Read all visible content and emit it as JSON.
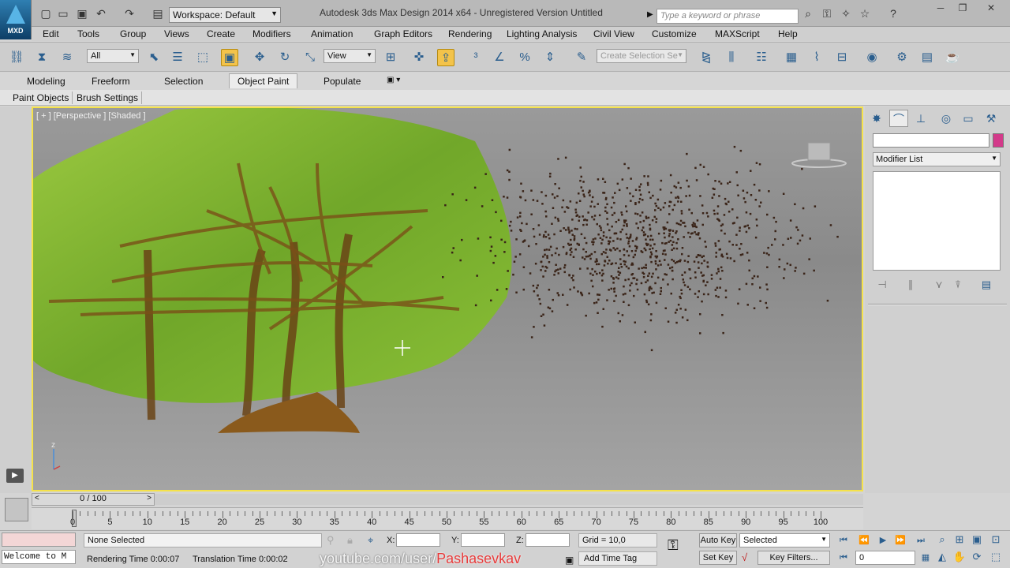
{
  "app": {
    "logo_text": "MXD",
    "title": "Autodesk 3ds Max Design 2014 x64    -   Unregistered Version       Untitled",
    "workspace": "Workspace: Default",
    "search_placeholder": "Type a keyword or phrase"
  },
  "menu": [
    "Edit",
    "Tools",
    "Group",
    "Views",
    "Create",
    "Modifiers",
    "Animation",
    "Graph Editors",
    "Rendering",
    "Lighting Analysis",
    "Civil View",
    "Customize",
    "MAXScript",
    "Help"
  ],
  "toolbar": {
    "filter_value": "All",
    "refcoord_value": "View",
    "selection_set_placeholder": "Create Selection Se"
  },
  "ribbon": {
    "tabs": [
      "Modeling",
      "Freeform",
      "Selection",
      "Object Paint",
      "Populate"
    ],
    "active_tab": "Object Paint",
    "subtabs": [
      "Paint Objects",
      "Brush Settings"
    ]
  },
  "viewport": {
    "label": "[ + ] [Perspective ] [Shaded ]",
    "active_border_color": "#f5e24a",
    "gizmo_label": "z"
  },
  "command_panel": {
    "modifier_list": "Modifier List",
    "object_color": "#d33a8a"
  },
  "timeline": {
    "slider_label": "0 / 100",
    "ticks": [
      0,
      5,
      10,
      15,
      20,
      25,
      30,
      35,
      40,
      45,
      50,
      55,
      60,
      65,
      70,
      75,
      80,
      85,
      90,
      95,
      100
    ]
  },
  "status": {
    "selection": "None Selected",
    "welcome": "Welcome to M",
    "x_label": "X:",
    "y_label": "Y:",
    "z_label": "Z:",
    "grid": "Grid = 10,0",
    "rendering_time": "Rendering Time  0:00:07",
    "translation_time": "Translation Time  0:00:02",
    "watermark_prefix": "youtube.com/user/",
    "watermark_user": "Pashasevkav",
    "add_time_tag": "Add Time Tag",
    "auto_key": "Auto Key",
    "set_key": "Set Key",
    "key_mode": "Selected",
    "key_filters": "Key Filters...",
    "frame": "0"
  }
}
